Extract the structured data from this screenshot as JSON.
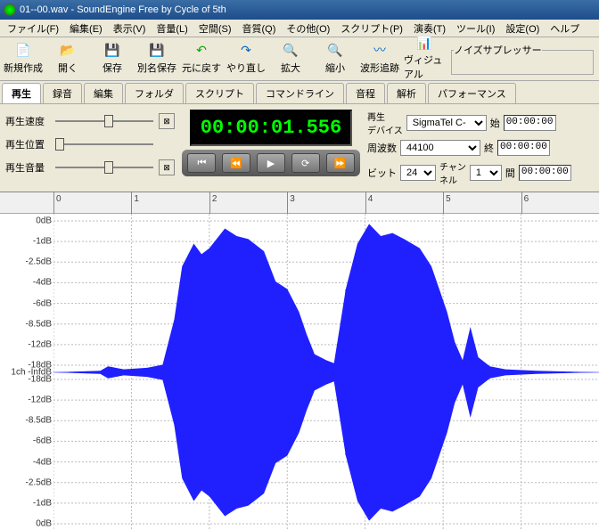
{
  "title": "01--00.wav - SoundEngine Free by Cycle of 5th",
  "menu": [
    "ファイル(F)",
    "編集(E)",
    "表示(V)",
    "音量(L)",
    "空間(S)",
    "音質(Q)",
    "その他(O)",
    "スクリプト(P)",
    "演奏(T)",
    "ツール(I)",
    "設定(O)",
    "ヘルプ"
  ],
  "toolbar": {
    "new": "新規作成",
    "open": "開く",
    "save": "保存",
    "saveas": "別名保存",
    "undo": "元に戻す",
    "redo": "やり直し",
    "zoomin": "拡大",
    "zoomout": "縮小",
    "track": "波形追跡",
    "visual": "ヴィジュアル"
  },
  "noise_panel_title": "ノイズサプレッサー",
  "tabs": [
    "再生",
    "録音",
    "編集",
    "フォルダ",
    "スクリプト",
    "コマンドライン",
    "音程",
    "解析",
    "パフォーマンス"
  ],
  "active_tab": 0,
  "sliders": {
    "speed": "再生速度",
    "position": "再生位置",
    "volume": "再生音量"
  },
  "timecode": "00:00:01.556",
  "device_label": "再生\nデバイス",
  "device": "SigmaTel C-",
  "freq_label": "周波数",
  "freq": "44100",
  "bit_label": "ビット",
  "bit": "24",
  "ch_label": "チャン\nネル",
  "ch": "1",
  "start_label": "始",
  "end_label": "終",
  "dur_label": "間",
  "time_start": "00:00:00",
  "time_end": "00:00:00",
  "time_dur": "00:00:00",
  "timeline": [
    "0",
    "1",
    "2",
    "3",
    "4",
    "5",
    "6"
  ],
  "db_labels_top": [
    "0dB",
    "-1dB",
    "-2.5dB",
    "-4dB",
    "-6dB",
    "-8.5dB",
    "-12dB",
    "-18dB"
  ],
  "ch_label_mid": "1ch -InfdB",
  "db_labels_bot": [
    "-18dB",
    "-12dB",
    "-8.5dB",
    "-6dB",
    "-4dB",
    "-2.5dB",
    "-1dB",
    "0dB"
  ],
  "chart_data": {
    "type": "waveform",
    "title": "",
    "x_unit": "seconds",
    "y_unit": "dB",
    "x_range": [
      0,
      7
    ],
    "y_ticks_db": [
      0,
      -1,
      -2.5,
      -4,
      -6,
      -8.5,
      -12,
      -18
    ],
    "envelope": [
      {
        "t": 0.0,
        "a": 0.0
      },
      {
        "t": 0.6,
        "a": 0.01
      },
      {
        "t": 0.7,
        "a": 0.04
      },
      {
        "t": 0.9,
        "a": 0.02
      },
      {
        "t": 1.2,
        "a": 0.03
      },
      {
        "t": 1.4,
        "a": 0.05
      },
      {
        "t": 1.55,
        "a": 0.35
      },
      {
        "t": 1.65,
        "a": 0.7
      },
      {
        "t": 1.8,
        "a": 0.85
      },
      {
        "t": 1.9,
        "a": 0.78
      },
      {
        "t": 2.0,
        "a": 0.82
      },
      {
        "t": 2.2,
        "a": 0.95
      },
      {
        "t": 2.35,
        "a": 0.9
      },
      {
        "t": 2.5,
        "a": 0.88
      },
      {
        "t": 2.7,
        "a": 0.8
      },
      {
        "t": 2.85,
        "a": 0.6
      },
      {
        "t": 3.0,
        "a": 0.55
      },
      {
        "t": 3.15,
        "a": 0.4
      },
      {
        "t": 3.25,
        "a": 0.25
      },
      {
        "t": 3.35,
        "a": 0.12
      },
      {
        "t": 3.5,
        "a": 0.08
      },
      {
        "t": 3.6,
        "a": 0.06
      },
      {
        "t": 3.75,
        "a": 0.55
      },
      {
        "t": 3.9,
        "a": 0.85
      },
      {
        "t": 4.05,
        "a": 0.98
      },
      {
        "t": 4.2,
        "a": 0.9
      },
      {
        "t": 4.35,
        "a": 0.92
      },
      {
        "t": 4.5,
        "a": 0.88
      },
      {
        "t": 4.7,
        "a": 0.82
      },
      {
        "t": 4.85,
        "a": 0.7
      },
      {
        "t": 4.95,
        "a": 0.55
      },
      {
        "t": 5.05,
        "a": 0.4
      },
      {
        "t": 5.15,
        "a": 0.2
      },
      {
        "t": 5.25,
        "a": 0.08
      },
      {
        "t": 5.35,
        "a": 0.3
      },
      {
        "t": 5.45,
        "a": 0.1
      },
      {
        "t": 5.6,
        "a": 0.04
      },
      {
        "t": 5.8,
        "a": 0.02
      },
      {
        "t": 6.2,
        "a": 0.01
      },
      {
        "t": 7.0,
        "a": 0.0
      }
    ]
  }
}
